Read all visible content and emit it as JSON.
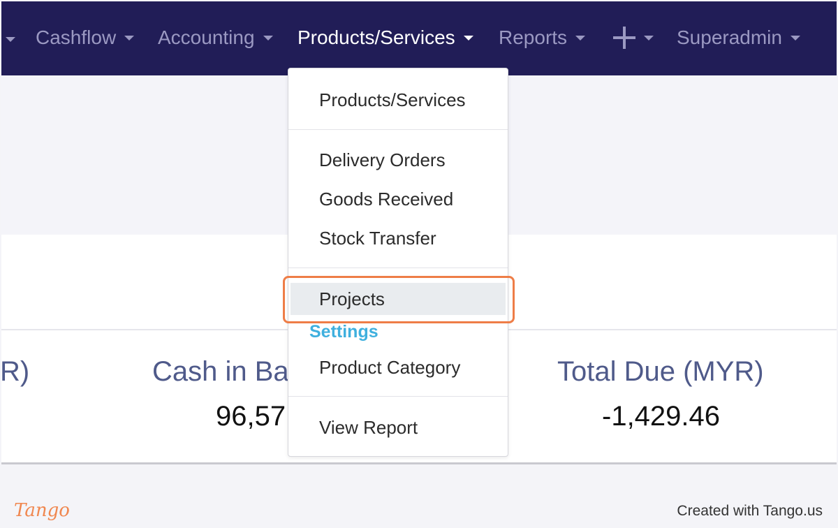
{
  "navbar": {
    "items": [
      {
        "label": "Cashflow"
      },
      {
        "label": "Accounting"
      },
      {
        "label": "Products/Services",
        "active": true
      },
      {
        "label": "Reports"
      },
      {
        "label": "",
        "icon": "plus-icon"
      },
      {
        "label": "Superadmin"
      }
    ],
    "colors": {
      "background": "#211d57",
      "inactive_text": "#9b99c2",
      "active_text": "#ffffff"
    }
  },
  "stats": [
    {
      "label": "R)",
      "value": ""
    },
    {
      "label": "Cash in Ba",
      "value": "96,57"
    },
    {
      "label": "Total Due (MYR)",
      "value": "-1,429.46"
    }
  ],
  "dropdown": {
    "items": {
      "products_services": "Products/Services",
      "delivery_orders": "Delivery Orders",
      "goods_received": "Goods Received",
      "stock_transfer": "Stock Transfer",
      "projects": "Projects",
      "product_category": "Product Category",
      "view_report": "View Report"
    },
    "settings_heading": "Settings",
    "highlighted": "Projects",
    "colors": {
      "heading": "#3fb0de",
      "highlight_ring": "#ee7d47"
    }
  },
  "footer": {
    "logo_text": "Tango",
    "created_with": "Created with Tango.us"
  }
}
